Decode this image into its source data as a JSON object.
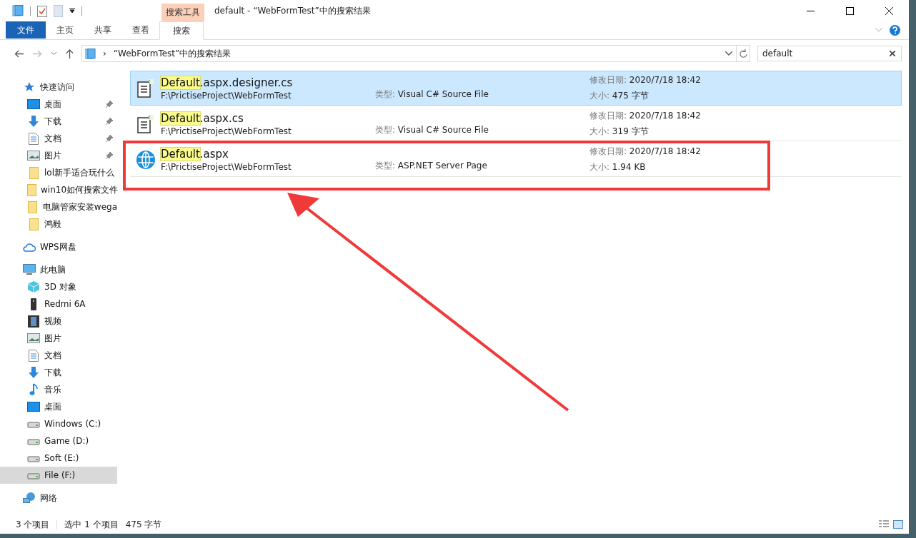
{
  "title_bar": {
    "context_group": "搜索工具",
    "title": "default - “WebFormTest”中的搜索结果"
  },
  "ribbon_tabs": [
    {
      "label": "文件",
      "kind": "file",
      "selected": false
    },
    {
      "label": "主页",
      "kind": "normal",
      "selected": false
    },
    {
      "label": "共享",
      "kind": "normal",
      "selected": false
    },
    {
      "label": "查看",
      "kind": "normal",
      "selected": false
    },
    {
      "label": "搜索",
      "kind": "context",
      "selected": true
    }
  ],
  "address_bar": {
    "separator": "›",
    "path": "“WebFormTest”中的搜索结果"
  },
  "search": {
    "value": "default"
  },
  "sidebar": {
    "items": [
      {
        "label": "快速访问",
        "kind": "star",
        "selected": false,
        "children": [
          {
            "label": "桌面",
            "kind": "desktop",
            "pinned": true,
            "selected": false
          },
          {
            "label": "下载",
            "kind": "download",
            "pinned": true,
            "selected": false
          },
          {
            "label": "文档",
            "kind": "document",
            "pinned": true,
            "selected": false
          },
          {
            "label": "图片",
            "kind": "picture",
            "pinned": true,
            "selected": false
          },
          {
            "label": "lol新手适合玩什么",
            "kind": "folder",
            "pinned": false,
            "selected": false
          },
          {
            "label": "win10如何搜索文件",
            "kind": "folder",
            "pinned": false,
            "selected": false
          },
          {
            "label": "电脑管家安装wega",
            "kind": "folder",
            "pinned": false,
            "selected": false
          },
          {
            "label": "鸿毅",
            "kind": "folder",
            "pinned": false,
            "selected": false
          }
        ]
      },
      {
        "label": "WPS网盘",
        "kind": "cloud",
        "selected": false
      },
      {
        "label": "此电脑",
        "kind": "computer",
        "selected": false,
        "children": [
          {
            "label": "3D 对象",
            "kind": "cube",
            "pinned": false,
            "selected": false
          },
          {
            "label": "Redmi 6A",
            "kind": "phone",
            "pinned": false,
            "selected": false
          },
          {
            "label": "视频",
            "kind": "video",
            "pinned": false,
            "selected": false
          },
          {
            "label": "图片",
            "kind": "picture",
            "pinned": false,
            "selected": false
          },
          {
            "label": "文档",
            "kind": "document",
            "pinned": false,
            "selected": false
          },
          {
            "label": "下载",
            "kind": "download",
            "pinned": false,
            "selected": false
          },
          {
            "label": "音乐",
            "kind": "music",
            "pinned": false,
            "selected": false
          },
          {
            "label": "桌面",
            "kind": "desktop",
            "pinned": false,
            "selected": false
          },
          {
            "label": "Windows (C:)",
            "kind": "drive",
            "pinned": false,
            "selected": false
          },
          {
            "label": "Game (D:)",
            "kind": "drive",
            "pinned": false,
            "selected": false
          },
          {
            "label": "Soft (E:)",
            "kind": "drive",
            "pinned": false,
            "selected": false
          },
          {
            "label": "File (F:)",
            "kind": "drive",
            "pinned": false,
            "selected": true
          }
        ]
      },
      {
        "label": "网络",
        "kind": "network",
        "selected": false
      }
    ]
  },
  "results": [
    {
      "kind": "csharp",
      "match": "Default",
      "rest": ".aspx.designer.cs",
      "path": "F:\\PrictiseProject\\WebFormTest",
      "type_label": "类型:",
      "type": "Visual C# Source File",
      "date_label": "修改日期:",
      "date": "2020/7/18 18:42",
      "size_label": "大小:",
      "size": "475 字节",
      "selected": true,
      "annotated": false
    },
    {
      "kind": "csharp",
      "match": "Default",
      "rest": ".aspx.cs",
      "path": "F:\\PrictiseProject\\WebFormTest",
      "type_label": "类型:",
      "type": "Visual C# Source File",
      "date_label": "修改日期:",
      "date": "2020/7/18 18:42",
      "size_label": "大小:",
      "size": "319 字节",
      "selected": false,
      "annotated": false
    },
    {
      "kind": "web",
      "match": "Default",
      "rest": ".aspx",
      "path": "F:\\PrictiseProject\\WebFormTest",
      "type_label": "类型:",
      "type": "ASP.NET Server Page",
      "date_label": "修改日期:",
      "date": "2020/7/18 18:42",
      "size_label": "大小:",
      "size": "1.94 KB",
      "selected": false,
      "annotated": true
    }
  ],
  "status_bar": {
    "item_count": "3 个项目",
    "selection": "选中 1 个项目",
    "selection_size": "475 字节"
  }
}
